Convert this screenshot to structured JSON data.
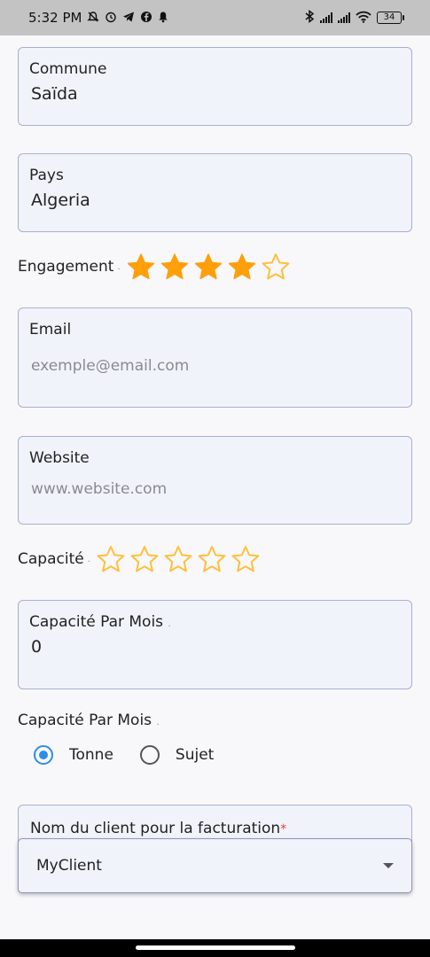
{
  "status_bar": {
    "time": "5:32 PM",
    "battery": "34",
    "left_icons": [
      "mute-icon",
      "alarm-icon",
      "telegram-icon",
      "facebook-icon",
      "bell-icon"
    ],
    "right_icons": [
      "bluetooth-icon",
      "signal-icon",
      "signal-icon",
      "wifi-icon",
      "battery-icon"
    ]
  },
  "form": {
    "commune": {
      "label": "Commune",
      "value": "Saïda"
    },
    "pays": {
      "label": "Pays",
      "value": "Algeria"
    },
    "engagement": {
      "label": "Engagement",
      "marker": ".",
      "rating": 4,
      "max": 5
    },
    "email": {
      "label": "Email",
      "placeholder": "exemple@email.com"
    },
    "website": {
      "label": "Website",
      "placeholder": "www.website.com"
    },
    "capacite": {
      "label": "Capacité",
      "marker": ".",
      "rating": 0,
      "max": 5
    },
    "capacite_par_mois": {
      "label": "Capacité Par Mois",
      "marker": ".",
      "value": "0"
    },
    "unit": {
      "label": "Capacité Par Mois",
      "marker": ".",
      "options": [
        {
          "label": "Tonne",
          "checked": true
        },
        {
          "label": "Sujet",
          "checked": false
        }
      ]
    },
    "client": {
      "label": "Nom du client pour la facturation",
      "required_mark": "*",
      "selected": "MyClient"
    }
  },
  "colors": {
    "star_filled": "#ff9f0a",
    "star_outline": "#ffbf3a",
    "radio_accent": "#2f8de4",
    "field_border": "#a8afcf",
    "field_bg": "#f1f3fb",
    "required": "#e0403a"
  }
}
